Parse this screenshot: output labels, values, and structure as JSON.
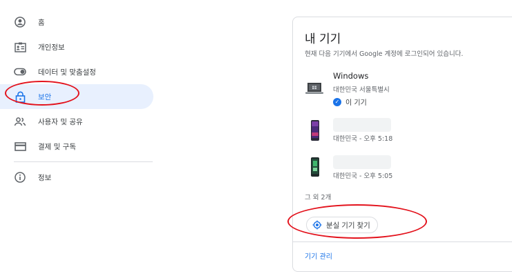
{
  "sidebar": {
    "items": [
      {
        "label": "홈",
        "icon": "account-circle-icon"
      },
      {
        "label": "개인정보",
        "icon": "id-card-icon"
      },
      {
        "label": "데이터 및 맞춤설정",
        "icon": "toggle-icon"
      },
      {
        "label": "보안",
        "icon": "lock-icon",
        "active": true
      },
      {
        "label": "사용자 및 공유",
        "icon": "people-icon"
      },
      {
        "label": "결제 및 구독",
        "icon": "credit-card-icon"
      },
      {
        "label": "정보",
        "icon": "info-icon"
      }
    ]
  },
  "devices_card": {
    "title": "내 기기",
    "subtitle": "현재 다음 기기에서 Google 계정에 로그인되어 있습니다.",
    "devices": [
      {
        "name": "Windows",
        "detail": "대한민국 서울특별시",
        "badge": "이 기기",
        "icon": "laptop-icon"
      },
      {
        "name": "",
        "detail": "대한민국 - 오후 5:18",
        "icon": "phone-icon"
      },
      {
        "name": "",
        "detail": "대한민국 - 오후 5:05",
        "icon": "phone-icon"
      }
    ],
    "more_text": "그 외 2개",
    "find_button": "분실 기기 찾기",
    "manage_link": "기기 관리"
  },
  "colors": {
    "accent": "#1a73e8",
    "annotation": "#e3121c",
    "active_bg": "#e8f0fe"
  }
}
